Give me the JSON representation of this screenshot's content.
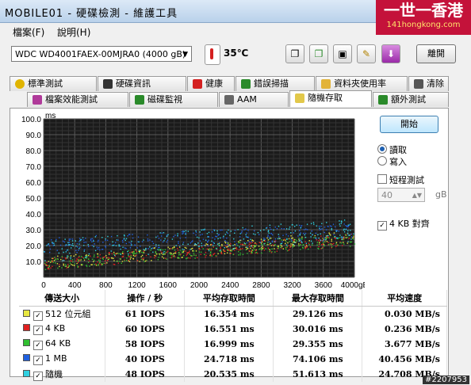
{
  "window": {
    "title": "MOBILE01 - 硬碟檢測 - 維護工具"
  },
  "brand": {
    "name": "一世一香港",
    "url_text": "141hongkong.com"
  },
  "menu": [
    "檔案(F)",
    "說明(H)"
  ],
  "toolbar": {
    "drive": "WDC WD4001FAEX-00MJRA0 (4000 gB)",
    "temperature": "35℃",
    "exit_label": "離開"
  },
  "tabs_top": [
    {
      "label": "標準測試",
      "icon": "bulb-icon",
      "color": "#e0b400"
    },
    {
      "label": "硬碟資訊",
      "icon": "info-icon",
      "color": "#333333"
    },
    {
      "label": "健康",
      "icon": "health-cross-icon",
      "color": "#d42020"
    },
    {
      "label": "錯誤掃描",
      "icon": "scan-icon",
      "color": "#2a8a2a"
    },
    {
      "label": "資料夾使用率",
      "icon": "folder-icon",
      "color": "#e2b33a"
    },
    {
      "label": "清除",
      "icon": "trash-icon",
      "color": "#555555"
    }
  ],
  "tabs_bottom": [
    {
      "label": "檔案效能測試",
      "icon": "file-benchmark-icon",
      "color": "#b03a9a"
    },
    {
      "label": "磁碟監視",
      "icon": "monitor-chart-icon",
      "color": "#2a8a2a"
    },
    {
      "label": "AAM",
      "icon": "speaker-icon",
      "color": "#666666"
    },
    {
      "label": "隨機存取",
      "icon": "random-access-icon",
      "color": "#e2c84a",
      "active": true
    },
    {
      "label": "額外測試",
      "icon": "extra-tests-icon",
      "color": "#2a8a2a"
    }
  ],
  "controls": {
    "start_label": "開始",
    "read_label": "讀取",
    "write_label": "寫入",
    "short_test_label": "短程測試",
    "short_test_value": "40",
    "short_test_unit": "gB",
    "align_label": "4 KB 對齊",
    "mode": "read",
    "short_test_checked": false,
    "align_checked": true
  },
  "chart_data": {
    "type": "scatter",
    "ylabel": "ms",
    "y_ticks": [
      "10.0",
      "20.0",
      "30.0",
      "40.0",
      "50.0",
      "60.0",
      "70.0",
      "80.0",
      "90.0",
      "100.0"
    ],
    "x_ticks": [
      "0",
      "400",
      "800",
      "1200",
      "1600",
      "2000",
      "2400",
      "2800",
      "3200",
      "3600",
      "4000gB"
    ],
    "xlim": [
      0,
      4000
    ],
    "ylim": [
      0,
      100
    ],
    "grid": true,
    "series": [
      {
        "name": "512 位元組",
        "color": "#e8e840",
        "trend": [
          [
            0,
            9
          ],
          [
            4000,
            26
          ]
        ],
        "spread": 4
      },
      {
        "name": "4 KB",
        "color": "#e02020",
        "trend": [
          [
            0,
            9
          ],
          [
            4000,
            24
          ]
        ],
        "spread": 4
      },
      {
        "name": "64 KB",
        "color": "#30c030",
        "trend": [
          [
            0,
            9
          ],
          [
            4000,
            24
          ]
        ],
        "spread": 4
      },
      {
        "name": "1 MB",
        "color": "#2060e0",
        "trend": [
          [
            0,
            20
          ],
          [
            4000,
            30
          ]
        ],
        "spread": 5
      },
      {
        "name": "隨機",
        "color": "#30d0e0",
        "trend": [
          [
            0,
            17
          ],
          [
            4000,
            30
          ]
        ],
        "spread": 7
      }
    ]
  },
  "results": {
    "headers": [
      "傳送大小",
      "操作 / 秒",
      "平均存取時間",
      "最大存取時間",
      "平均速度"
    ],
    "rows": [
      {
        "size": "512 位元組",
        "color": "#e8e840",
        "iops": "61 IOPS",
        "avg": "16.354 ms",
        "max": "29.126 ms",
        "speed": "0.030 MB/s"
      },
      {
        "size": "4 KB",
        "color": "#e02020",
        "iops": "60 IOPS",
        "avg": "16.551 ms",
        "max": "30.016 ms",
        "speed": "0.236 MB/s"
      },
      {
        "size": "64 KB",
        "color": "#30c030",
        "iops": "58 IOPS",
        "avg": "16.999 ms",
        "max": "29.355 ms",
        "speed": "3.677 MB/s"
      },
      {
        "size": "1 MB",
        "color": "#2060e0",
        "iops": "40 IOPS",
        "avg": "24.718 ms",
        "max": "74.106 ms",
        "speed": "40.456 MB/s"
      },
      {
        "size": "隨機",
        "color": "#30d0e0",
        "iops": "48 IOPS",
        "avg": "20.535 ms",
        "max": "51.613 ms",
        "speed": "24.708 MB/s"
      }
    ]
  },
  "badge": "#2207953"
}
